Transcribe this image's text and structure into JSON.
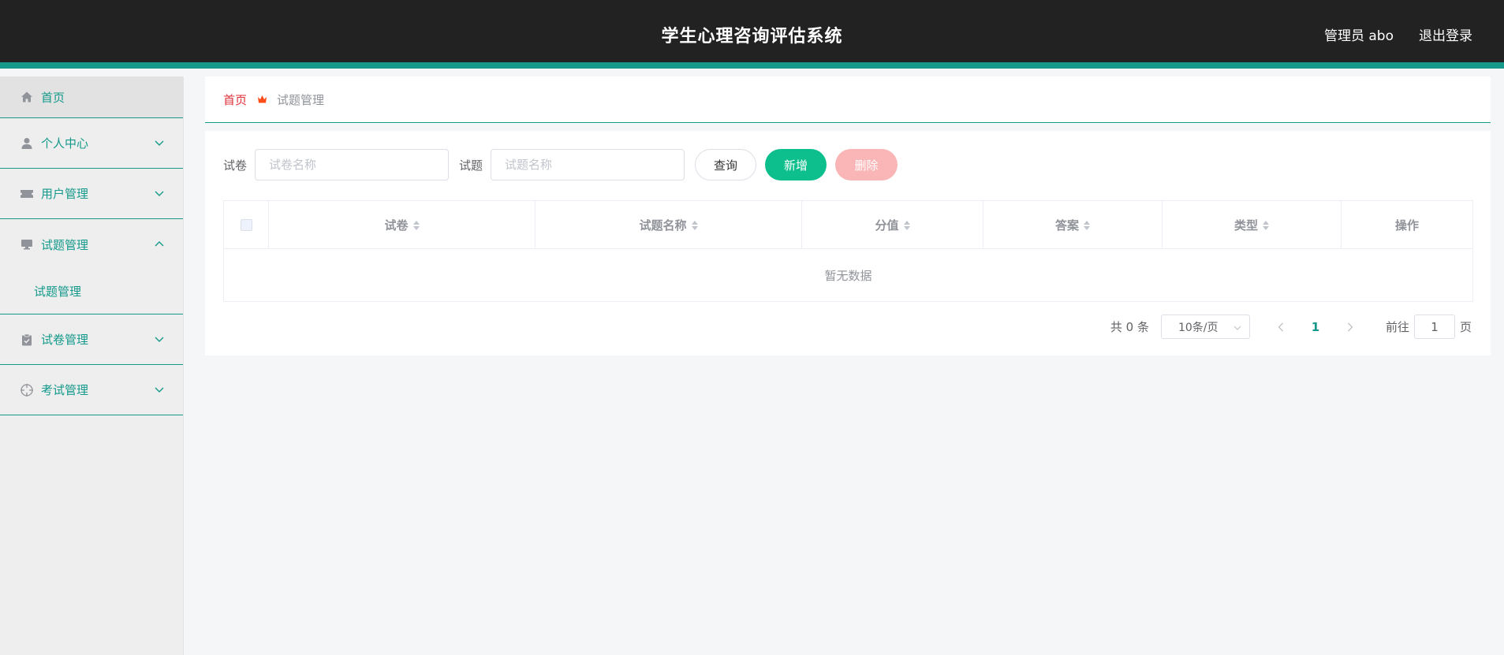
{
  "header": {
    "title": "学生心理咨询评估系统",
    "user_label": "管理员 abo",
    "logout_label": "退出登录",
    "bg_color": "#222222",
    "accent_color": "#14998b"
  },
  "sidebar": {
    "items": [
      {
        "label": "首页",
        "icon": "home-icon"
      },
      {
        "label": "个人中心",
        "icon": "user-icon"
      },
      {
        "label": "用户管理",
        "icon": "ticket-icon"
      },
      {
        "label": "试题管理",
        "icon": "monitor-icon"
      },
      {
        "label": "试卷管理",
        "icon": "clipboard-icon"
      },
      {
        "label": "考试管理",
        "icon": "crosshair-icon"
      }
    ],
    "sub_item": "试题管理"
  },
  "breadcrumb": {
    "home": "首页",
    "current": "试题管理"
  },
  "search": {
    "paper_label": "试卷",
    "paper_placeholder": "试卷名称",
    "question_label": "试题",
    "question_placeholder": "试题名称",
    "query_button": "查询",
    "add_button": "新增",
    "delete_button": "删除"
  },
  "table": {
    "columns": [
      "试卷",
      "试题名称",
      "分值",
      "答案",
      "类型",
      "操作"
    ],
    "empty_text": "暂无数据"
  },
  "pagination": {
    "total": "共 0 条",
    "page_size": "10条/页",
    "current_page": "1",
    "goto_label": "前往",
    "goto_value": "1",
    "page_suffix": "页"
  }
}
